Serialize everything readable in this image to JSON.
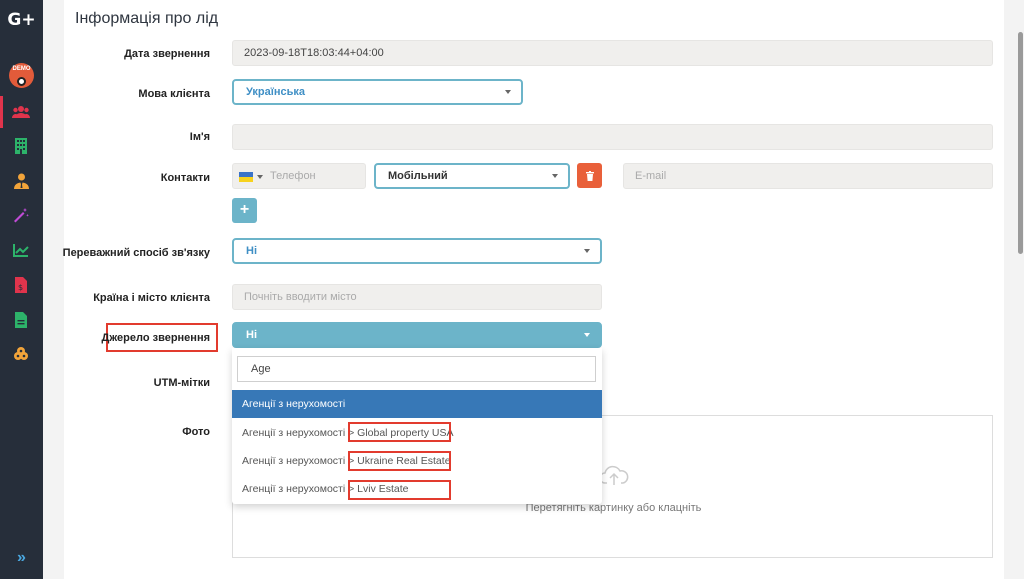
{
  "app": {
    "logo": "G+",
    "demo_badge": "DEMO"
  },
  "section_title": "Інформація про лід",
  "fields": {
    "date": {
      "label": "Дата звернення",
      "value": "2023-09-18T18:03:44+04:00"
    },
    "language": {
      "label": "Мова клієнта",
      "value": "Українська"
    },
    "name": {
      "label": "Ім'я",
      "value": ""
    },
    "contacts": {
      "label": "Контакти",
      "phone_placeholder": "Телефон",
      "phone_type": "Мобільний",
      "email_placeholder": "E-mail",
      "add_label": "+"
    },
    "preferred_contact": {
      "label": "Переважний спосіб зв'язку",
      "value": "Ні"
    },
    "country_city": {
      "label": "Країна і місто клієнта",
      "placeholder": "Почніть вводити місто"
    },
    "source": {
      "label": "Джерело звернення",
      "value": "Ні"
    },
    "utm": {
      "label": "UTM-мітки"
    },
    "photo": {
      "label": "Фото",
      "dropzone_text": "Перетягніть картинку або клацніть"
    }
  },
  "dropdown": {
    "search_value": "Age",
    "options": [
      {
        "prefix": "Агенції з нерухомості",
        "suffix": ""
      },
      {
        "prefix": "Агенції з нерухомості >",
        "suffix": "Global property USA"
      },
      {
        "prefix": "Агенції з нерухомості >",
        "suffix": "Ukraine Real Estate"
      },
      {
        "prefix": "Агенції з нерухомості >",
        "suffix": "Lviv Estate"
      }
    ]
  },
  "sidebar": {
    "items": [
      {
        "icon": "users-icon",
        "color": "#e0344c"
      },
      {
        "icon": "building-icon",
        "color": "#2db36a"
      },
      {
        "icon": "user-tie-icon",
        "color": "#f2a43a"
      },
      {
        "icon": "magic-wand-icon",
        "color": "#c04bd6"
      },
      {
        "icon": "chart-line-icon",
        "color": "#2db36a"
      },
      {
        "icon": "file-invoice-icon",
        "color": "#e0344c"
      },
      {
        "icon": "file-text-icon",
        "color": "#2db36a"
      },
      {
        "icon": "cookie-icon",
        "color": "#f2a43a"
      }
    ],
    "expand": "»"
  },
  "colors": {
    "accent": "#6cb4c9",
    "danger": "#e9603a",
    "highlight": "#3778b7",
    "annotation": "#e23b2e"
  }
}
